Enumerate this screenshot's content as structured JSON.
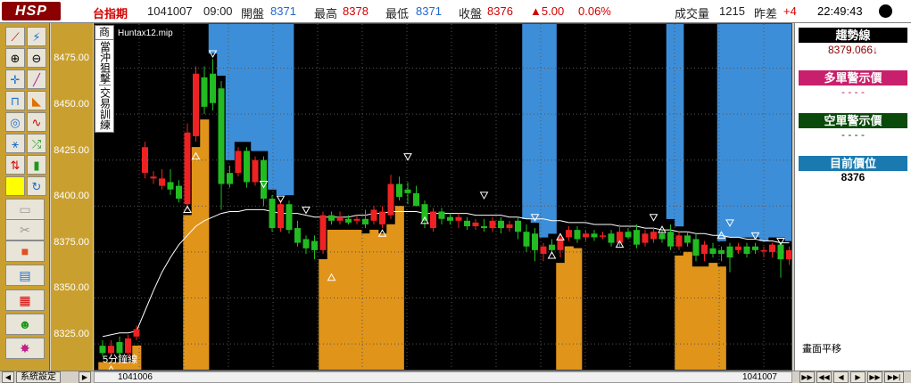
{
  "header": {
    "logo": "HSP",
    "symbol": "台指期",
    "date": "1041007",
    "time": "09:00",
    "open_label": "開盤",
    "open": "8371",
    "high_label": "最高",
    "high": "8378",
    "low_label": "最低",
    "low": "8371",
    "close_label": "收盤",
    "close": "8376",
    "change": "▲5.00",
    "change_pct": "0.06%",
    "volume_label": "成交量",
    "volume": "1215",
    "diff_label": "昨差",
    "diff": "+4",
    "clock": "22:49:43"
  },
  "chart": {
    "side_tab_top": "商",
    "side_tab_mid": "當沖狙擊",
    "side_tab_bottom": "交易訓練",
    "filename": "Huntax12.mip",
    "period_label": "5分鐘線",
    "y_ticks": [
      "8475.00",
      "8450.00",
      "8425.00",
      "8400.00",
      "8375.00",
      "8350.00",
      "8325.00"
    ]
  },
  "right_panel": {
    "trend_label": "趨勢線",
    "trend_value": "8379.066↓",
    "long_label": "多單警示價",
    "long_value": "- - - -",
    "short_label": "空單警示價",
    "short_value": "- - - -",
    "pos_label": "目前價位",
    "pos_value": "8376",
    "note": "畫面平移"
  },
  "footer": {
    "sys_button": "系統設定",
    "date_left": "1041006",
    "date_right": "1041007"
  },
  "colors": {
    "accent_red": "#d40000",
    "accent_blue": "#2266cc",
    "panel_gold": "#c9a030",
    "zone_orange": "#e0941a",
    "zone_blue": "#3d8ed8",
    "candle_up": "#ee2222",
    "candle_down": "#22bb22",
    "trend_line": "#ffffff"
  },
  "chart_data": {
    "type": "candlestick",
    "ylim": [
      8311,
      8499
    ],
    "y_ticks": [
      8475,
      8450,
      8425,
      8400,
      8375,
      8350,
      8325
    ],
    "x_labels": [
      "1041006",
      "1041007"
    ],
    "candles": [
      {
        "o": 8324,
        "c": 8320,
        "h": 8327,
        "l": 8318
      },
      {
        "o": 8320,
        "c": 8324,
        "h": 8327,
        "l": 8318
      },
      {
        "o": 8326,
        "c": 8320,
        "h": 8329,
        "l": 8318
      },
      {
        "o": 8320,
        "c": 8328,
        "h": 8330,
        "l": 8318
      },
      {
        "o": 8329,
        "c": 8333,
        "h": 8335,
        "l": 8327
      },
      {
        "o": 8418,
        "c": 8432,
        "h": 8435,
        "l": 8415
      },
      {
        "o": 8415,
        "c": 8416,
        "h": 8419,
        "l": 8412
      },
      {
        "o": 8411,
        "c": 8415,
        "h": 8420,
        "l": 8409
      },
      {
        "o": 8413,
        "c": 8409,
        "h": 8420,
        "l": 8406
      },
      {
        "o": 8411,
        "c": 8404,
        "h": 8414,
        "l": 8402
      },
      {
        "o": 8401,
        "c": 8440,
        "h": 8445,
        "l": 8398
      },
      {
        "o": 8438,
        "c": 8472,
        "h": 8476,
        "l": 8435
      },
      {
        "o": 8470,
        "c": 8454,
        "h": 8476,
        "l": 8450
      },
      {
        "o": 8472,
        "c": 8456,
        "h": 8480,
        "l": 8452
      },
      {
        "o": 8464,
        "c": 8412,
        "h": 8468,
        "l": 8398
      },
      {
        "o": 8418,
        "c": 8412,
        "h": 8422,
        "l": 8410
      },
      {
        "o": 8418,
        "c": 8430,
        "h": 8432,
        "l": 8416
      },
      {
        "o": 8430,
        "c": 8413,
        "h": 8432,
        "l": 8410
      },
      {
        "o": 8413,
        "c": 8425,
        "h": 8427,
        "l": 8411
      },
      {
        "o": 8425,
        "c": 8404,
        "h": 8427,
        "l": 8400
      },
      {
        "o": 8404,
        "c": 8388,
        "h": 8406,
        "l": 8386
      },
      {
        "o": 8388,
        "c": 8401,
        "h": 8403,
        "l": 8386
      },
      {
        "o": 8401,
        "c": 8387,
        "h": 8403,
        "l": 8385
      },
      {
        "o": 8388,
        "c": 8380,
        "h": 8392,
        "l": 8378
      },
      {
        "o": 8382,
        "c": 8377,
        "h": 8384,
        "l": 8374
      },
      {
        "o": 8381,
        "c": 8376,
        "h": 8384,
        "l": 8371
      },
      {
        "o": 8376,
        "c": 8395,
        "h": 8397,
        "l": 8374
      },
      {
        "o": 8395,
        "c": 8392,
        "h": 8397,
        "l": 8390
      },
      {
        "o": 8392,
        "c": 8394,
        "h": 8397,
        "l": 8390
      },
      {
        "o": 8393,
        "c": 8391,
        "h": 8395,
        "l": 8390
      },
      {
        "o": 8392,
        "c": 8393,
        "h": 8395,
        "l": 8390
      },
      {
        "o": 8393,
        "c": 8390,
        "h": 8398,
        "l": 8388
      },
      {
        "o": 8392,
        "c": 8398,
        "h": 8400,
        "l": 8390
      },
      {
        "o": 8390,
        "c": 8397,
        "h": 8400,
        "l": 8388
      },
      {
        "o": 8395,
        "c": 8412,
        "h": 8417,
        "l": 8393
      },
      {
        "o": 8412,
        "c": 8405,
        "h": 8416,
        "l": 8403
      },
      {
        "o": 8409,
        "c": 8407,
        "h": 8413,
        "l": 8401
      },
      {
        "o": 8407,
        "c": 8400,
        "h": 8411,
        "l": 8400
      },
      {
        "o": 8401,
        "c": 8392,
        "h": 8403,
        "l": 8388
      },
      {
        "o": 8388,
        "c": 8397,
        "h": 8399,
        "l": 8386
      },
      {
        "o": 8397,
        "c": 8393,
        "h": 8399,
        "l": 8390
      },
      {
        "o": 8394,
        "c": 8392,
        "h": 8396,
        "l": 8390
      },
      {
        "o": 8392,
        "c": 8394,
        "h": 8396,
        "l": 8388
      },
      {
        "o": 8392,
        "c": 8389,
        "h": 8394,
        "l": 8387
      },
      {
        "o": 8389,
        "c": 8391,
        "h": 8393,
        "l": 8387
      },
      {
        "o": 8389,
        "c": 8388,
        "h": 8393,
        "l": 8386
      },
      {
        "o": 8388,
        "c": 8392,
        "h": 8394,
        "l": 8386
      },
      {
        "o": 8392,
        "c": 8388,
        "h": 8394,
        "l": 8385
      },
      {
        "o": 8388,
        "c": 8390,
        "h": 8392,
        "l": 8386
      },
      {
        "o": 8392,
        "c": 8386,
        "h": 8394,
        "l": 8382
      },
      {
        "o": 8386,
        "c": 8378,
        "h": 8390,
        "l": 8375
      },
      {
        "o": 8385,
        "c": 8376,
        "h": 8388,
        "l": 8370
      },
      {
        "o": 8374,
        "c": 8378,
        "h": 8380,
        "l": 8370
      },
      {
        "o": 8379,
        "c": 8376,
        "h": 8382,
        "l": 8374
      },
      {
        "o": 8376,
        "c": 8383,
        "h": 8385,
        "l": 8372
      },
      {
        "o": 8383,
        "c": 8387,
        "h": 8389,
        "l": 8381
      },
      {
        "o": 8387,
        "c": 8382,
        "h": 8389,
        "l": 8380
      },
      {
        "o": 8383,
        "c": 8385,
        "h": 8387,
        "l": 8381
      },
      {
        "o": 8385,
        "c": 8383,
        "h": 8387,
        "l": 8381
      },
      {
        "o": 8384,
        "c": 8384,
        "h": 8386,
        "l": 8382
      },
      {
        "o": 8385,
        "c": 8380,
        "h": 8387,
        "l": 8378
      },
      {
        "o": 8380,
        "c": 8386,
        "h": 8390,
        "l": 8378
      },
      {
        "o": 8386,
        "c": 8383,
        "h": 8388,
        "l": 8382
      },
      {
        "o": 8387,
        "c": 8379,
        "h": 8390,
        "l": 8377
      },
      {
        "o": 8380,
        "c": 8385,
        "h": 8387,
        "l": 8378
      },
      {
        "o": 8382,
        "c": 8386,
        "h": 8388,
        "l": 8380
      },
      {
        "o": 8385,
        "c": 8382,
        "h": 8387,
        "l": 8380
      },
      {
        "o": 8386,
        "c": 8378,
        "h": 8390,
        "l": 8376
      },
      {
        "o": 8378,
        "c": 8384,
        "h": 8386,
        "l": 8376
      },
      {
        "o": 8384,
        "c": 8380,
        "h": 8386,
        "l": 8378
      },
      {
        "o": 8382,
        "c": 8373,
        "h": 8385,
        "l": 8370
      },
      {
        "o": 8374,
        "c": 8379,
        "h": 8381,
        "l": 8370
      },
      {
        "o": 8377,
        "c": 8374,
        "h": 8380,
        "l": 8372
      },
      {
        "o": 8376,
        "c": 8374,
        "h": 8378,
        "l": 8370
      },
      {
        "o": 8378,
        "c": 8372,
        "h": 8380,
        "l": 8364
      },
      {
        "o": 8376,
        "c": 8378,
        "h": 8380,
        "l": 8374
      },
      {
        "o": 8378,
        "c": 8374,
        "h": 8380,
        "l": 8372
      },
      {
        "o": 8378,
        "c": 8376,
        "h": 8380,
        "l": 8374
      },
      {
        "o": 8376,
        "c": 8376,
        "h": 8378,
        "l": 8372
      },
      {
        "o": 8375,
        "c": 8379,
        "h": 8380,
        "l": 8372
      },
      {
        "o": 8379,
        "c": 8371,
        "h": 8380,
        "l": 8361
      },
      {
        "o": 8371,
        "c": 8376,
        "h": 8378,
        "l": 8368
      }
    ],
    "trend_line": [
      8329,
      8330,
      8331,
      8331,
      8332,
      8343,
      8354,
      8364,
      8372,
      8379,
      8384,
      8389,
      8392,
      8394,
      8396,
      8397,
      8397,
      8398,
      8398,
      8398,
      8397,
      8396,
      8396,
      8396,
      8395,
      8394,
      8394,
      8394,
      8394,
      8394,
      8395,
      8395,
      8396,
      8396,
      8397,
      8397,
      8397,
      8397,
      8396,
      8396,
      8396,
      8396,
      8396,
      8396,
      8395,
      8395,
      8395,
      8395,
      8394,
      8394,
      8393,
      8393,
      8393,
      8392,
      8392,
      8391,
      8391,
      8391,
      8390,
      8390,
      8390,
      8389,
      8389,
      8389,
      8388,
      8388,
      8387,
      8387,
      8386,
      8386,
      8385,
      8385,
      8384,
      8384,
      8383,
      8383,
      8382,
      8382,
      8381,
      8381,
      8380,
      8380
    ],
    "zones_long": [
      [
        0,
        4
      ],
      [
        10,
        12
      ],
      [
        26,
        35
      ],
      [
        54,
        56
      ],
      [
        68,
        73
      ]
    ],
    "zones_short": [
      [
        13,
        22
      ],
      [
        50,
        53
      ],
      [
        67,
        68
      ],
      [
        73,
        81
      ]
    ],
    "signals_up": [
      [
        1,
        8311
      ],
      [
        10,
        8398
      ],
      [
        11,
        8427
      ],
      [
        27,
        8361
      ],
      [
        33,
        8385
      ],
      [
        38,
        8392
      ],
      [
        53,
        8373
      ],
      [
        54,
        8383
      ],
      [
        61,
        8379
      ],
      [
        66,
        8387
      ],
      [
        73,
        8384
      ]
    ],
    "signals_down": [
      [
        13,
        8483
      ],
      [
        19,
        8412
      ],
      [
        21,
        8404
      ],
      [
        24,
        8398
      ],
      [
        36,
        8427
      ],
      [
        45,
        8406
      ],
      [
        51,
        8394
      ],
      [
        65,
        8394
      ],
      [
        74,
        8391
      ],
      [
        77,
        8384
      ],
      [
        80,
        8381
      ]
    ]
  }
}
